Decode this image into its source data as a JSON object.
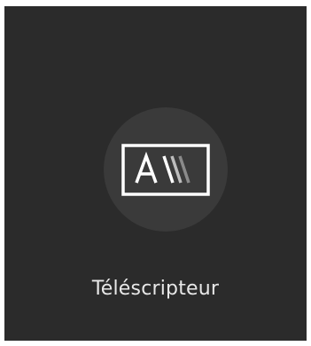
{
  "app": {
    "label": "Téléscripteur",
    "icon": "teleprompter-icon"
  },
  "colors": {
    "tile_background": "#2b2b2b",
    "icon_circle": "#3a3a3a",
    "label_text": "#e8e8e8",
    "icon_primary": "#ffffff",
    "icon_fade_1": "#bdbdbd",
    "icon_fade_2": "#8a8a8a"
  }
}
